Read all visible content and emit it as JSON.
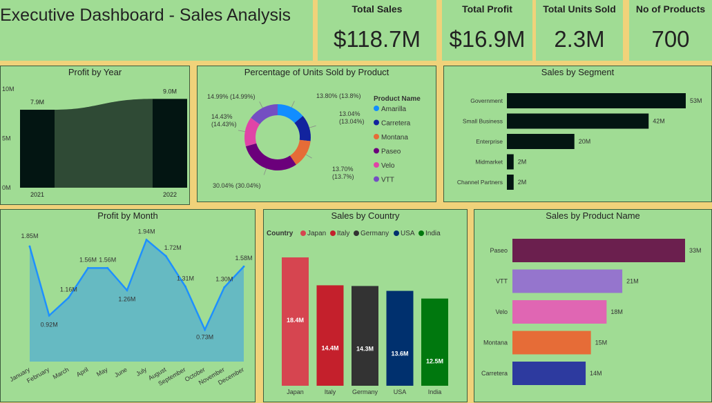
{
  "header": {
    "title": "Executive Dashboard - Sales Analysis",
    "kpis": [
      {
        "label": "Total Sales",
        "value": "$118.7M"
      },
      {
        "label": "Total Profit",
        "value": "$16.9M"
      },
      {
        "label": "Total Units Sold",
        "value": "2.3M"
      },
      {
        "label": "No of Products",
        "value": "700"
      }
    ]
  },
  "colors": {
    "panel_bg": "#a0dc94",
    "page_bg": "#f0d27a",
    "dark_bar": "#031512",
    "line_blue": "#1e90ff",
    "area_fill": "#5fb6c6"
  },
  "chart_data": [
    {
      "type": "area",
      "title": "Profit by Year",
      "categories": [
        "2021",
        "2022"
      ],
      "values": [
        7.9,
        9.0
      ],
      "data_labels": [
        "7.9M",
        "9.0M"
      ],
      "y_ticks": [
        "0M",
        "5M",
        "10M"
      ],
      "ylim": [
        0,
        10
      ]
    },
    {
      "type": "pie",
      "title": "Percentage of Units Sold by Product",
      "legend_title": "Product Name",
      "series": [
        {
          "name": "Amarilla",
          "value": 13.8,
          "label": "13.80% (13.8%)",
          "color": "#118dff"
        },
        {
          "name": "Carretera",
          "value": 13.04,
          "label": "13.04% (13.04%)",
          "color": "#12239e"
        },
        {
          "name": "Montana",
          "value": 13.7,
          "label": "13.70% (13.7%)",
          "color": "#e66c37"
        },
        {
          "name": "Paseo",
          "value": 30.04,
          "label": "30.04% (30.04%)",
          "color": "#6b007b"
        },
        {
          "name": "Velo",
          "value": 14.43,
          "label": "14.43% (14.43%)",
          "color": "#e044a7"
        },
        {
          "name": "VTT",
          "value": 14.99,
          "label": "14.99% (14.99%)",
          "color": "#744ec2"
        }
      ]
    },
    {
      "type": "bar",
      "title": "Sales by Segment",
      "categories": [
        "Government",
        "Small Business",
        "Enterprise",
        "Midmarket",
        "Channel Partners"
      ],
      "values": [
        53,
        42,
        20,
        2,
        2
      ],
      "data_labels": [
        "53M",
        "42M",
        "20M",
        "2M",
        "2M"
      ],
      "color": "#031512"
    },
    {
      "type": "area",
      "title": "Profit by Month",
      "categories": [
        "January",
        "February",
        "March",
        "April",
        "May",
        "June",
        "July",
        "August",
        "September",
        "October",
        "November",
        "December"
      ],
      "values": [
        1.85,
        0.92,
        1.16,
        1.56,
        1.56,
        1.26,
        1.94,
        1.72,
        1.31,
        0.73,
        1.3,
        1.58
      ],
      "data_labels": [
        "1.85M",
        "0.92M",
        "1.16M",
        "1.56M",
        "1.56M",
        "1.26M",
        "1.94M",
        "1.72M",
        "1.31M",
        "0.73M",
        "1.30M",
        "1.58M"
      ]
    },
    {
      "type": "bar",
      "title": "Sales by Country",
      "legend_title": "Country",
      "categories": [
        "Japan",
        "Italy",
        "Germany",
        "USA",
        "India"
      ],
      "values": [
        18.4,
        14.4,
        14.3,
        13.6,
        12.5
      ],
      "data_labels": [
        "18.4M",
        "14.4M",
        "14.3M",
        "13.6M",
        "12.5M"
      ],
      "colors": [
        "#d64550",
        "#c4202c",
        "#333333",
        "#00306e",
        "#00780e"
      ]
    },
    {
      "type": "bar",
      "title": "Sales by Product Name",
      "categories": [
        "Paseo",
        "VTT",
        "Velo",
        "Montana",
        "Carretera"
      ],
      "values": [
        33,
        21,
        18,
        15,
        14
      ],
      "data_labels": [
        "33M",
        "21M",
        "18M",
        "15M",
        "14M"
      ],
      "colors": [
        "#6b1f4e",
        "#9575cd",
        "#e066b3",
        "#e66c37",
        "#2d3a9f"
      ]
    }
  ]
}
